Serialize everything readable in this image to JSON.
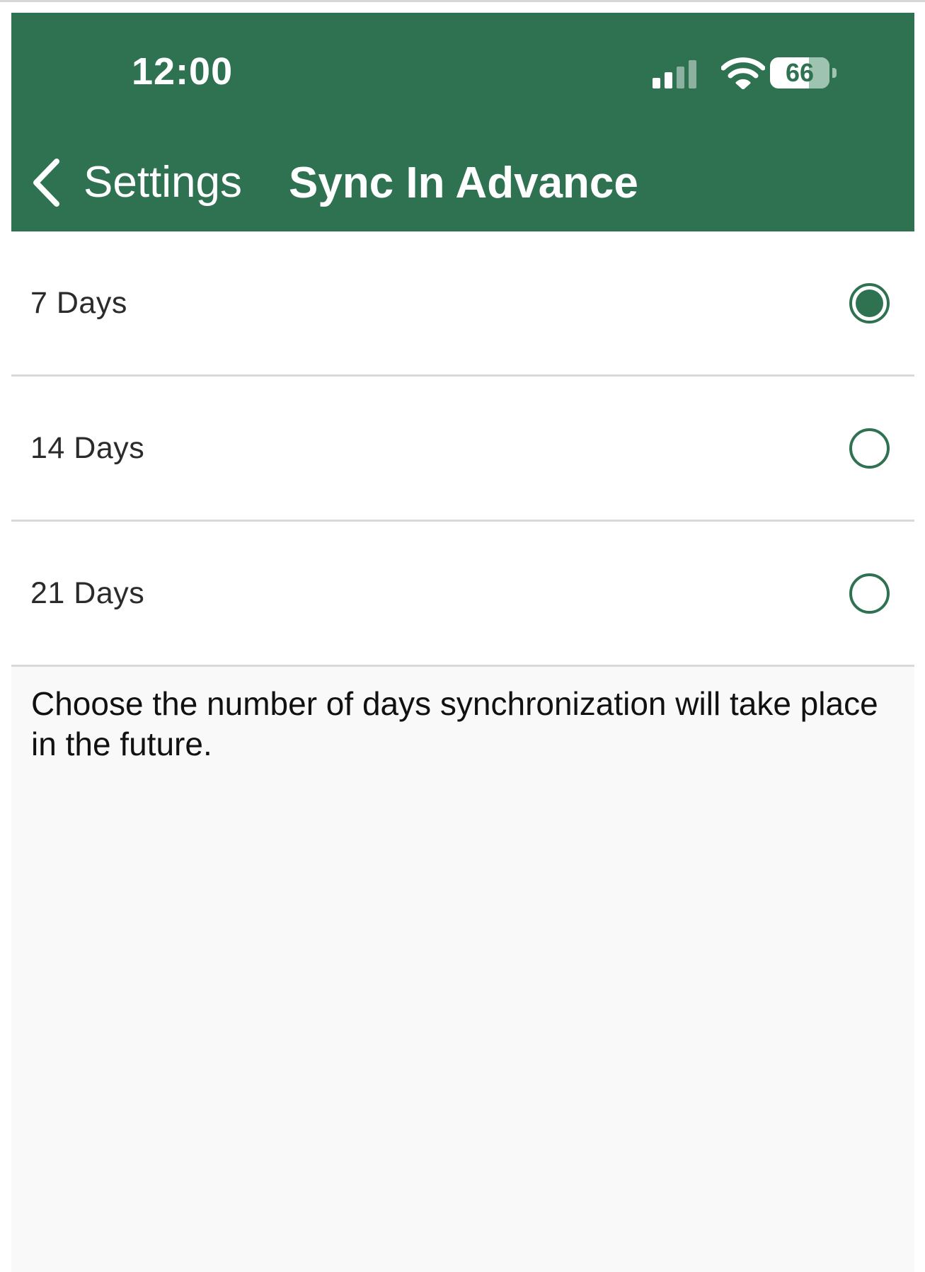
{
  "theme": {
    "accent_color": "#2f7252",
    "background_color": "#f9f9f9",
    "divider_color": "#d9d9d9"
  },
  "status_bar": {
    "time": "12:00",
    "signal_icon": "cellular-signal-icon",
    "signal_bars_active": 2,
    "signal_bars_total": 4,
    "wifi_icon": "wifi-icon",
    "battery_icon": "battery-icon",
    "battery_percent": "66",
    "battery_level": 0.66
  },
  "nav_bar": {
    "back_icon": "chevron-left-icon",
    "back_label": "Settings",
    "title": "Sync In Advance"
  },
  "options": [
    {
      "label": "7 Days",
      "selected": true
    },
    {
      "label": "14 Days",
      "selected": false
    },
    {
      "label": "21 Days",
      "selected": false
    }
  ],
  "footer": {
    "description": "Choose the number of days synchronization will take place in the future."
  }
}
